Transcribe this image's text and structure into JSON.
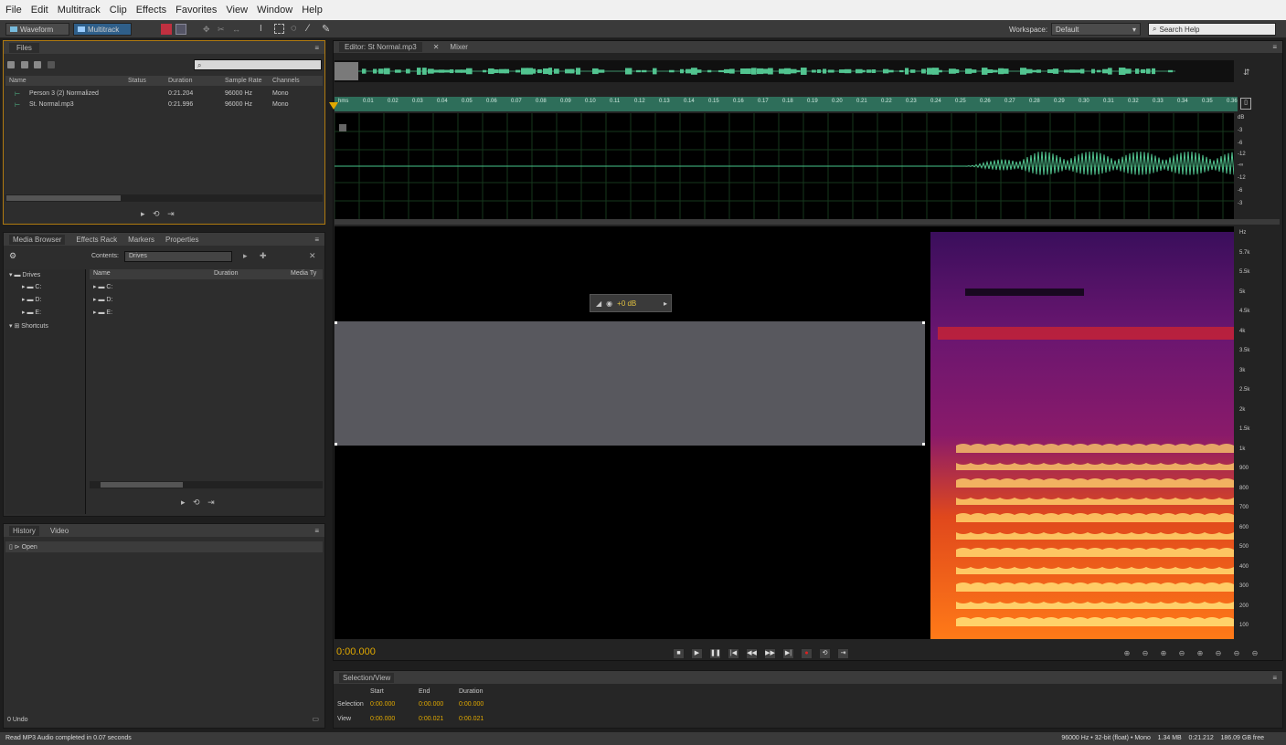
{
  "menu": [
    "File",
    "Edit",
    "Multitrack",
    "Clip",
    "Effects",
    "Favorites",
    "View",
    "Window",
    "Help"
  ],
  "toolbar": {
    "waveform_label": "Waveform",
    "multitrack_label": "Multitrack",
    "workspace_label": "Workspace:",
    "workspace_value": "Default",
    "search_placeholder": "Search Help"
  },
  "files_panel": {
    "tab": "Files",
    "columns": [
      "Name",
      "Status",
      "Duration",
      "Sample Rate",
      "Channels"
    ],
    "rows": [
      {
        "name": "Person 3 (2) Normalized",
        "duration": "0:21.204",
        "rate": "96000 Hz",
        "channels": "Mono"
      },
      {
        "name": "St. Normal.mp3",
        "duration": "0:21.996",
        "rate": "96000 Hz",
        "channels": "Mono"
      }
    ]
  },
  "media_panel": {
    "tabs": [
      "Media Browser",
      "Effects Rack",
      "Markers",
      "Properties"
    ],
    "contents_label": "Contents:",
    "contents_value": "Drives",
    "tree": [
      "Drives",
      "C:",
      "D:",
      "E:",
      "Shortcuts"
    ],
    "columns": [
      "Name",
      "Duration",
      "Media Ty"
    ],
    "list": [
      "C:",
      "D:",
      "E:"
    ]
  },
  "history_panel": {
    "tabs": [
      "History",
      "Video"
    ],
    "items": [
      "Open"
    ],
    "footer": "0 Undo"
  },
  "editor": {
    "tabs": [
      "Editor: St Normal.mp3",
      "Mixer"
    ],
    "ruler_labels": [
      "hms",
      "0.01",
      "0.02",
      "0.03",
      "0.04",
      "0.05",
      "0.06",
      "0.07",
      "0.08",
      "0.09",
      "0.10",
      "0.11",
      "0.12",
      "0.13",
      "0.14",
      "0.15",
      "0.16",
      "0.17",
      "0.18",
      "0.19",
      "0.20",
      "0.21",
      "0.22",
      "0.23",
      "0.24",
      "0.25",
      "0.26",
      "0.27",
      "0.28",
      "0.29",
      "0.30",
      "0.31",
      "0.32",
      "0.33",
      "0.34",
      "0.35",
      "0.36"
    ],
    "db_labels": [
      "dB",
      "-3",
      "-6",
      "-12",
      "-∞",
      "-12",
      "-6",
      "-3"
    ],
    "hud_value": "+0 dB",
    "freq_labels": [
      "Hz",
      "5.7k",
      "5.5k",
      "5k",
      "4.5k",
      "4k",
      "3.5k",
      "3k",
      "2.5k",
      "2k",
      "1.5k",
      "1k",
      "900",
      "800",
      "700",
      "600",
      "500",
      "400",
      "300",
      "200",
      "100"
    ],
    "time_display": "0:00.000"
  },
  "transport": [
    "■",
    "▶",
    "❚❚",
    "|◀",
    "◀◀",
    "▶▶",
    "▶|",
    "●",
    "⟲",
    "⇥"
  ],
  "zoom": [
    "⊕",
    "⊖",
    "⊕",
    "⊖",
    "⊕",
    "⊖",
    "⊖",
    "⊖"
  ],
  "selection_view": {
    "tab": "Selection/View",
    "columns": [
      "Start",
      "End",
      "Duration"
    ],
    "selection_label": "Selection",
    "selection": [
      "0:00.000",
      "0:00.000",
      "0:00.000"
    ],
    "view_label": "View",
    "view": [
      "0:00.000",
      "0:00.021",
      "0:00.021"
    ]
  },
  "status": {
    "left": "Read MP3 Audio completed in 0.07 seconds",
    "right": "96000 Hz • 32-bit (float) • Mono    1.34 MB    0:21.212    186.09 GB free"
  }
}
